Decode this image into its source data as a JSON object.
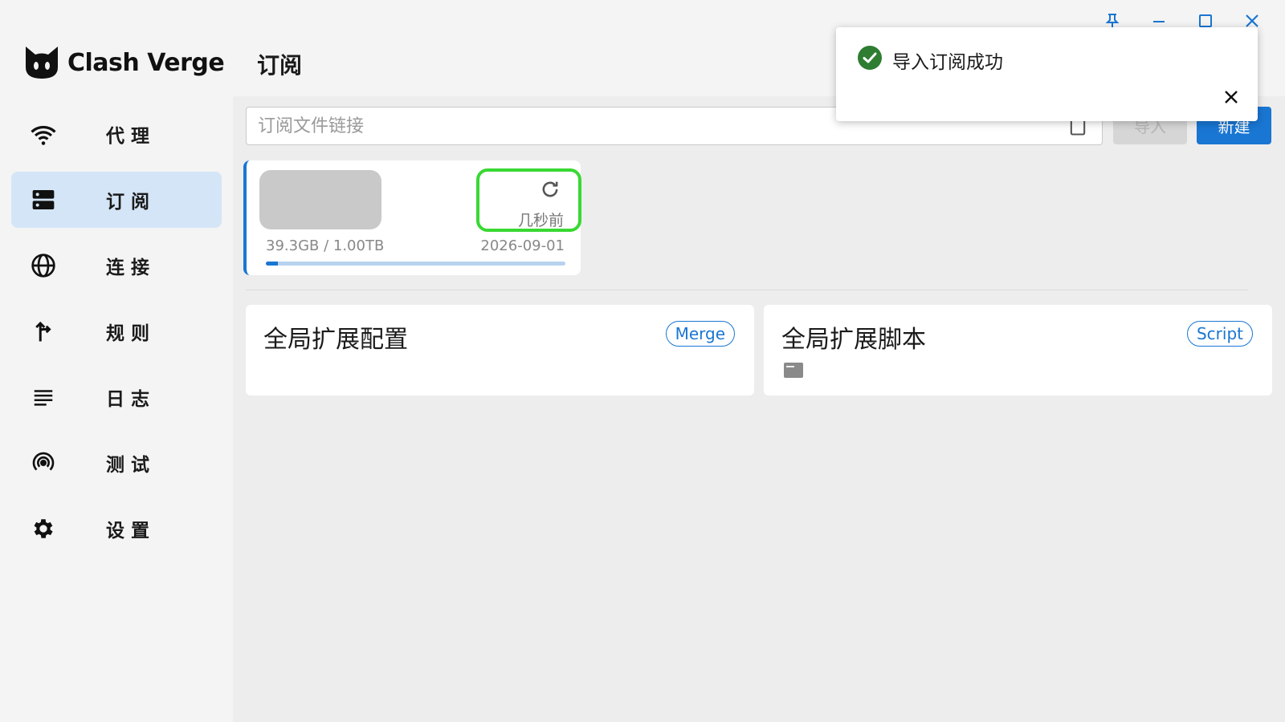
{
  "app": {
    "name": "Clash Verge"
  },
  "sidebar": {
    "items": [
      {
        "label": "代理",
        "icon": "wifi-icon",
        "active": false
      },
      {
        "label": "订阅",
        "icon": "dns-icon",
        "active": true
      },
      {
        "label": "连接",
        "icon": "globe-icon",
        "active": false
      },
      {
        "label": "规则",
        "icon": "fork-arrow-icon",
        "active": false
      },
      {
        "label": "日志",
        "icon": "list-icon",
        "active": false
      },
      {
        "label": "测试",
        "icon": "broadcast-icon",
        "active": false
      },
      {
        "label": "设置",
        "icon": "gear-icon",
        "active": false
      }
    ]
  },
  "header": {
    "title": "订阅"
  },
  "toolbar": {
    "url_placeholder": "订阅文件链接",
    "url_value": "",
    "import_label": "导入",
    "new_label": "新建"
  },
  "profile": {
    "updated": "几秒前",
    "usage": "39.3GB / 1.00TB",
    "expire": "2026-09-01",
    "usage_fraction": 0.04
  },
  "extensions": {
    "merge": {
      "title": "全局扩展配置",
      "tag": "Merge"
    },
    "script": {
      "title": "全局扩展脚本",
      "tag": "Script"
    }
  },
  "toast": {
    "message": "导入订阅成功"
  },
  "colors": {
    "accent": "#1976d2",
    "active_nav": "#d4e5f7",
    "success": "#2e7d32",
    "highlight": "#39d833"
  }
}
